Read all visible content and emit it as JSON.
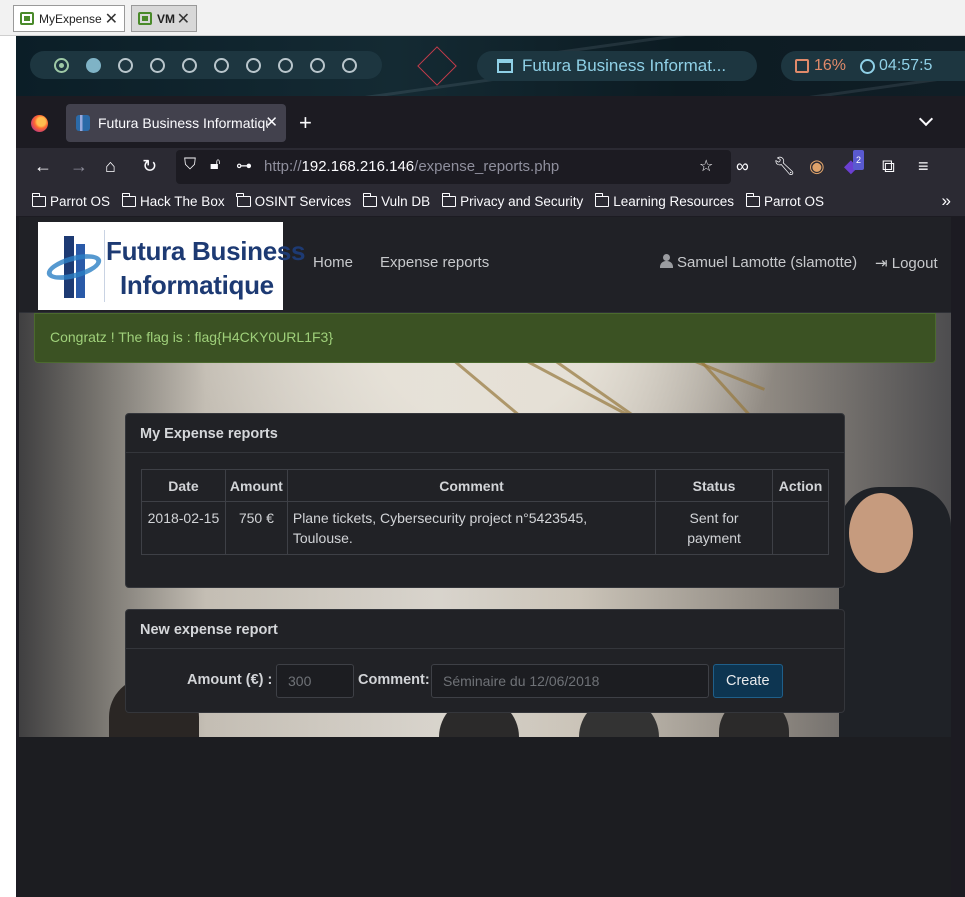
{
  "host": {
    "tabs": [
      {
        "label": "MyExpense",
        "active": false
      },
      {
        "label": "VM",
        "active": true
      }
    ]
  },
  "panel": {
    "workspaces": 10,
    "window_title": "Futura Business Informat...",
    "cpu": "16%",
    "clock": "04:57:5"
  },
  "browser": {
    "tab_title": "Futura Business Informatique",
    "url_prefix": "http://",
    "url_host": "192.168.216.146",
    "url_path": "/expense_reports.php",
    "bookmarks": [
      "Parrot OS",
      "Hack The Box",
      "OSINT Services",
      "Vuln DB",
      "Privacy and Security",
      "Learning Resources",
      "Parrot OS"
    ],
    "ext_badge": "2"
  },
  "site": {
    "logo_line1": "Futura Business",
    "logo_line2": "Informatique",
    "nav": {
      "home": "Home",
      "expense_reports": "Expense reports"
    },
    "user": "Samuel Lamotte (slamotte)",
    "logout": "Logout",
    "alert": "Congratz ! The flag is : flag{H4CKY0URL1F3}",
    "reports": {
      "title": "My Expense reports",
      "columns": [
        "Date",
        "Amount",
        "Comment",
        "Status",
        "Action"
      ],
      "rows": [
        {
          "date": "2018-02-15",
          "amount": "750 €",
          "comment": "Plane tickets, Cybersecurity project n°5423545, Toulouse.",
          "status": "Sent for payment",
          "action": ""
        }
      ]
    },
    "new_report": {
      "title": "New expense report",
      "amount_label": "Amount (€) :",
      "amount_placeholder": "300",
      "comment_label": "Comment:",
      "comment_placeholder": "Séminaire du 12/06/2018",
      "create_label": "Create"
    }
  }
}
